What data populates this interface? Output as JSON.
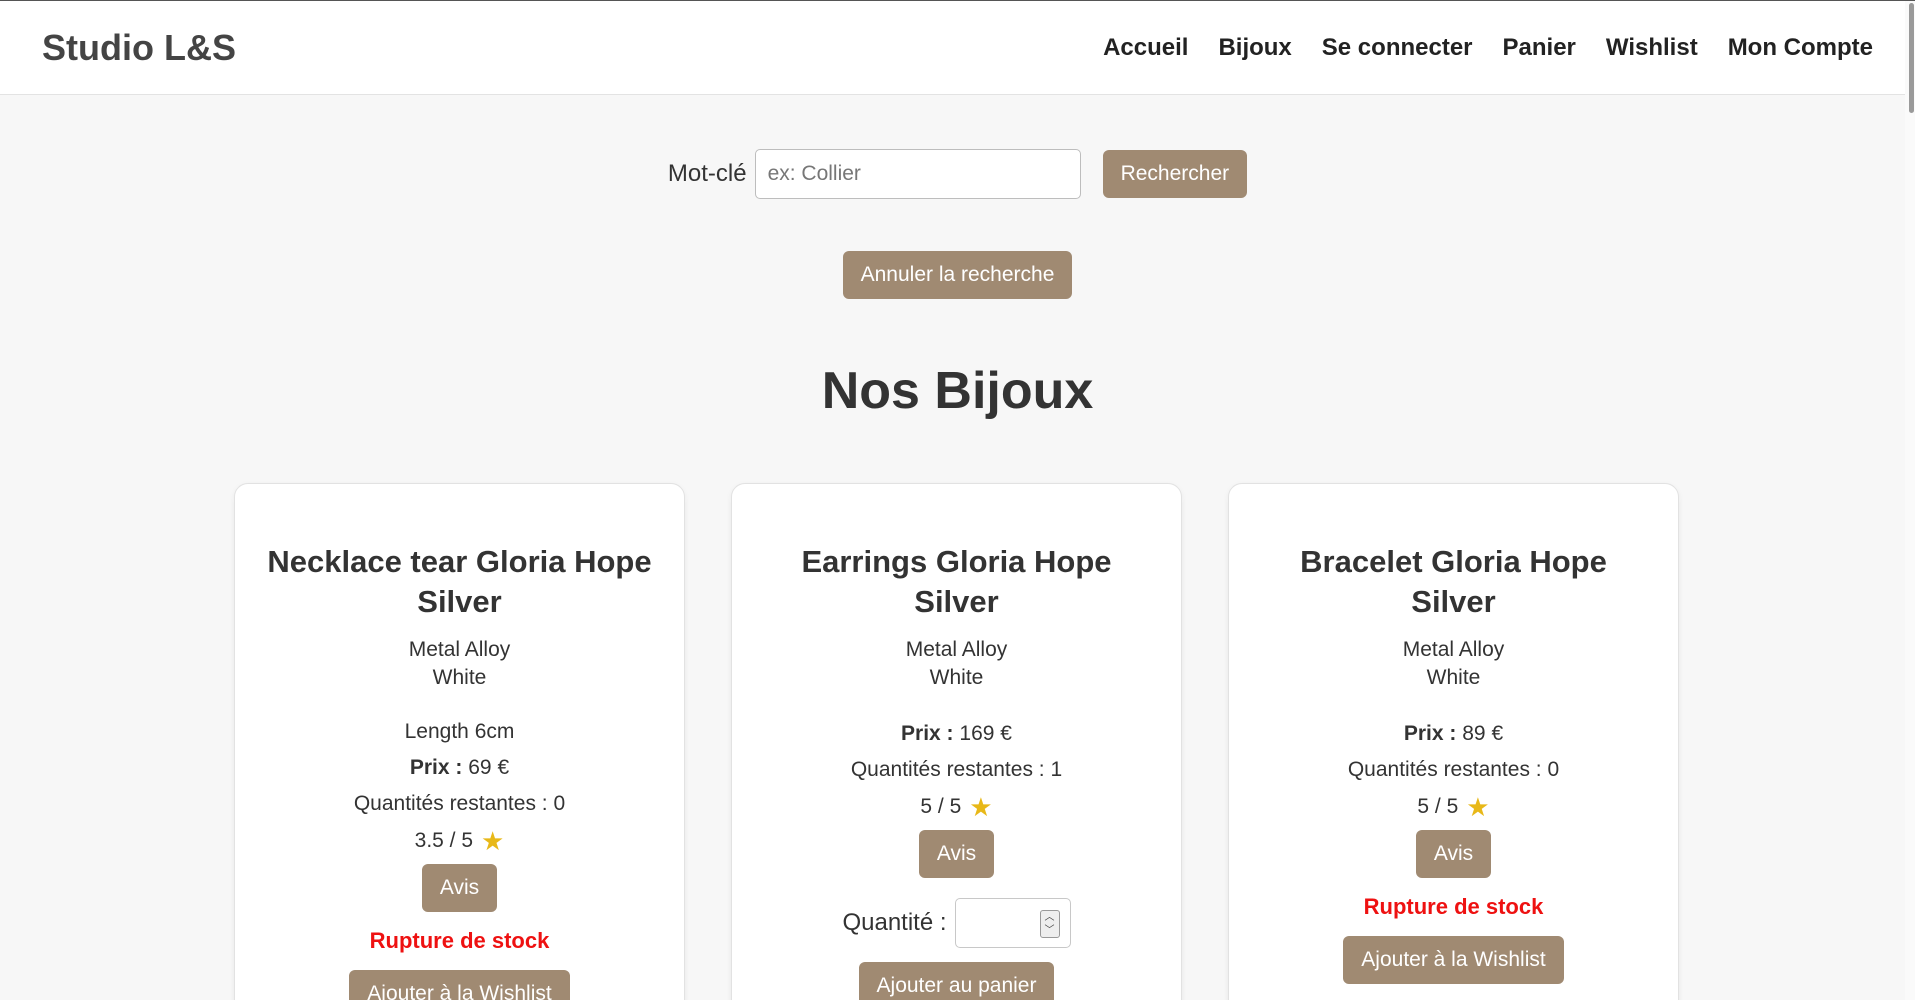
{
  "header": {
    "brand": "Studio L&S",
    "nav": [
      "Accueil",
      "Bijoux",
      "Se connecter",
      "Panier",
      "Wishlist",
      "Mon Compte"
    ]
  },
  "search": {
    "label": "Mot-clé",
    "placeholder": "ex: Collier",
    "button": "Rechercher",
    "cancel": "Annuler la recherche"
  },
  "page_title": "Nos Bijoux",
  "labels": {
    "price": "Prix :",
    "avis": "Avis",
    "out_of_stock": "Rupture de stock",
    "wishlist_button": "Ajouter à la Wishlist",
    "quantity": "Quantité :",
    "add_to_cart": "Ajouter au panier"
  },
  "products": [
    {
      "name": "Necklace tear Gloria Hope Silver",
      "material": "Metal Alloy",
      "color": "White",
      "length": "Length 6cm",
      "price": "69 €",
      "remaining": "Quantités restantes : 0",
      "rating": "3.5 / 5"
    },
    {
      "name": "Earrings Gloria Hope Silver",
      "material": "Metal Alloy",
      "color": "White",
      "price": "169 €",
      "remaining": "Quantités restantes : 1",
      "rating": "5 / 5"
    },
    {
      "name": "Bracelet Gloria Hope Silver",
      "material": "Metal Alloy",
      "color": "White",
      "price": "89 €",
      "remaining": "Quantités restantes : 0",
      "rating": "5 / 5"
    }
  ],
  "icons": {
    "star": "star-icon",
    "spinner": "number-spinner-icon"
  },
  "colors": {
    "button": "#a08a72",
    "out_of_stock": "#ee1111",
    "star": "#e8b818"
  }
}
